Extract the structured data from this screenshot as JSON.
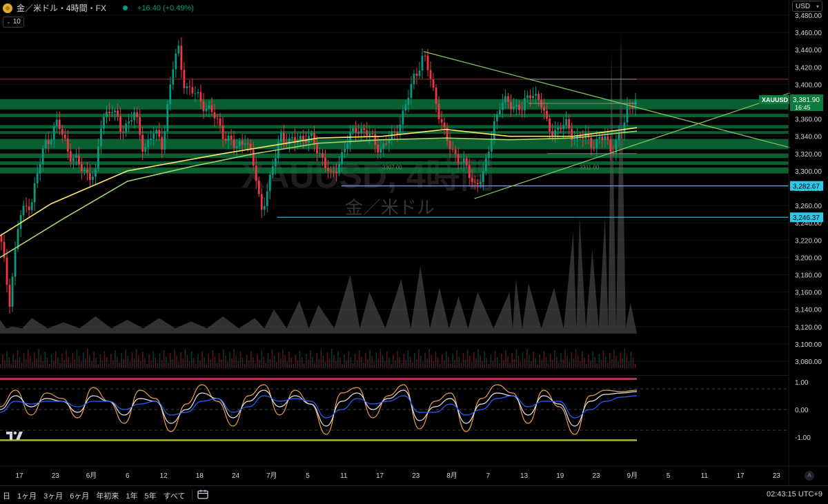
{
  "header": {
    "symbol_title": "金／米ドル・4時間・FX",
    "change": "+16.40 (+0.49%)",
    "interval_badge": "10",
    "currency": "USD"
  },
  "watermark": {
    "ticker": "XAUUSD, 4時間",
    "description": "金／米ドル"
  },
  "colors": {
    "background": "#000000",
    "up": "#089981",
    "down": "#f23645",
    "ma_yellow": "#ffeb6b",
    "ma_green": "#a5d66f",
    "trendline": "#7fc45c",
    "zone": "#0d7a3e",
    "hline_blue": "#2ec9e8",
    "hline_red": "#a22a2a",
    "osc_orange": "#f0a04b",
    "osc_white": "#e8e8e8",
    "osc_blue": "#2962ff"
  },
  "chart_data": [
    {
      "type": "candlestick",
      "title": "XAUUSD, 4時間",
      "symbol": "XAUUSD",
      "last_price": "3,381.90",
      "countdown": "16:45",
      "ylim": [
        3080,
        3480
      ],
      "y_ticks": [
        "3,480.00",
        "3,460.00",
        "3,440.00",
        "3,420.00",
        "3,400.00",
        "3,380.00",
        "3,360.00",
        "3,340.00",
        "3,320.00",
        "3,300.00",
        "3,280.00",
        "3,260.00",
        "3,240.00",
        "3,220.00",
        "3,200.00",
        "3,180.00",
        "3,160.00",
        "3,140.00",
        "3,120.00",
        "3,100.00",
        "3,080.00"
      ],
      "x_ticks": [
        "17",
        "23",
        "6月",
        "6",
        "12",
        "18",
        "24",
        "7月",
        "5",
        "11",
        "17",
        "23",
        "8月",
        "7",
        "13",
        "19",
        "23",
        "9月",
        "5",
        "11",
        "17",
        "23"
      ],
      "close_path": [
        [
          0,
          3225
        ],
        [
          0.015,
          3150
        ],
        [
          0.03,
          3245
        ],
        [
          0.05,
          3268
        ],
        [
          0.07,
          3330
        ],
        [
          0.09,
          3355
        ],
        [
          0.11,
          3320
        ],
        [
          0.13,
          3300
        ],
        [
          0.15,
          3295
        ],
        [
          0.16,
          3360
        ],
        [
          0.175,
          3375
        ],
        [
          0.19,
          3345
        ],
        [
          0.21,
          3368
        ],
        [
          0.225,
          3325
        ],
        [
          0.24,
          3345
        ],
        [
          0.255,
          3330
        ],
        [
          0.27,
          3415
        ],
        [
          0.28,
          3440
        ],
        [
          0.29,
          3400
        ],
        [
          0.31,
          3385
        ],
        [
          0.33,
          3370
        ],
        [
          0.35,
          3345
        ],
        [
          0.37,
          3325
        ],
        [
          0.385,
          3340
        ],
        [
          0.4,
          3300
        ],
        [
          0.41,
          3255
        ],
        [
          0.425,
          3290
        ],
        [
          0.44,
          3345
        ],
        [
          0.455,
          3330
        ],
        [
          0.47,
          3340
        ],
        [
          0.49,
          3335
        ],
        [
          0.505,
          3318
        ],
        [
          0.52,
          3290
        ],
        [
          0.54,
          3325
        ],
        [
          0.56,
          3352
        ],
        [
          0.58,
          3340
        ],
        [
          0.6,
          3325
        ],
        [
          0.62,
          3345
        ],
        [
          0.635,
          3368
        ],
        [
          0.65,
          3410
        ],
        [
          0.665,
          3432
        ],
        [
          0.675,
          3410
        ],
        [
          0.69,
          3365
        ],
        [
          0.7,
          3335
        ],
        [
          0.715,
          3320
        ],
        [
          0.73,
          3305
        ],
        [
          0.745,
          3285
        ],
        [
          0.76,
          3295
        ],
        [
          0.775,
          3355
        ],
        [
          0.785,
          3375
        ],
        [
          0.8,
          3380
        ],
        [
          0.82,
          3370
        ],
        [
          0.835,
          3395
        ],
        [
          0.85,
          3375
        ],
        [
          0.86,
          3352
        ],
        [
          0.875,
          3345
        ],
        [
          0.89,
          3355
        ],
        [
          0.905,
          3335
        ],
        [
          0.92,
          3340
        ],
        [
          0.935,
          3330
        ],
        [
          0.95,
          3340
        ],
        [
          0.96,
          3325
        ],
        [
          0.975,
          3340
        ],
        [
          0.985,
          3375
        ],
        [
          1.0,
          3382
        ]
      ],
      "moving_averages": [
        {
          "points": [
            [
              0,
              3225
            ],
            [
              0.08,
              3262
            ],
            [
              0.2,
              3300
            ],
            [
              0.35,
              3320
            ],
            [
              0.5,
              3338
            ],
            [
              0.6,
              3340
            ],
            [
              0.7,
              3348
            ],
            [
              0.8,
              3340
            ],
            [
              0.9,
              3340
            ],
            [
              1.0,
              3350
            ]
          ]
        },
        {
          "points": [
            [
              0,
              3200
            ],
            [
              0.1,
              3245
            ],
            [
              0.2,
              3288
            ],
            [
              0.3,
              3305
            ],
            [
              0.4,
              3320
            ],
            [
              0.5,
              3332
            ],
            [
              0.6,
              3336
            ],
            [
              0.7,
              3338
            ],
            [
              0.8,
              3336
            ],
            [
              0.9,
              3338
            ],
            [
              1.0,
              3346
            ]
          ]
        }
      ],
      "zones": [
        [
          3371,
          3383
        ],
        [
          3362,
          3366
        ],
        [
          3349,
          3353
        ],
        [
          3343,
          3346
        ],
        [
          3325,
          3337
        ],
        [
          3315,
          3320
        ],
        [
          3307,
          3311
        ],
        [
          3297,
          3304
        ]
      ],
      "horizontal_lines": [
        {
          "price": 3282.67,
          "label": "3,282.67",
          "x_from": 0.536,
          "color": "blue"
        },
        {
          "price": 3246.37,
          "label": "3,246.37",
          "x_from": 0.435,
          "color": "blue"
        },
        {
          "price": 3406,
          "x_from": 0.0,
          "color": "red"
        },
        {
          "price": 3406,
          "x_from": 0.83,
          "color": "gray"
        },
        {
          "price": 3378,
          "x_from": 0.83,
          "color": "gray"
        },
        {
          "price": 3320,
          "x_from": 0.86,
          "color": "gray"
        }
      ],
      "trendlines": [
        {
          "from": [
            0.665,
            3438
          ],
          "to": [
            1.24,
            3327
          ]
        },
        {
          "from": [
            0.745,
            3268
          ],
          "to": [
            1.24,
            3390
          ]
        }
      ],
      "small_labels": [
        {
          "text": "3307.00",
          "x": 0.6,
          "price": 3302
        },
        {
          "text": "3311.00",
          "x": 0.91,
          "price": 3302
        }
      ],
      "volume_peaks": [
        [
          0.47,
          3150
        ],
        [
          0.5,
          3145
        ],
        [
          0.55,
          3180
        ],
        [
          0.58,
          3160
        ],
        [
          0.63,
          3175
        ],
        [
          0.66,
          3190
        ],
        [
          0.69,
          3165
        ],
        [
          0.72,
          3155
        ],
        [
          0.75,
          3160
        ],
        [
          0.8,
          3160
        ],
        [
          0.81,
          3175
        ],
        [
          0.83,
          3170
        ],
        [
          0.87,
          3165
        ],
        [
          0.9,
          3230
        ],
        [
          0.91,
          3248
        ],
        [
          0.93,
          3210
        ],
        [
          0.95,
          3248
        ],
        [
          0.96,
          3440
        ],
        [
          0.975,
          3462
        ],
        [
          0.99,
          3148
        ]
      ]
    },
    {
      "type": "line",
      "title": "",
      "ylim": [
        -1.15,
        1.15
      ],
      "y_ticks": [
        "1.00",
        "0.00",
        "-1.00"
      ],
      "levels": [
        0.75,
        0,
        -0.75
      ],
      "series": [
        {
          "color": "orange",
          "values": [
            0.1,
            0.7,
            -0.2,
            0.6,
            0.4,
            -0.3,
            0.8,
            0.3,
            -0.5,
            0.7,
            0.4,
            -0.8,
            0.2,
            0.9,
            0.3,
            -0.6,
            0.5,
            0.9,
            -0.2,
            0.7,
            0.2,
            -0.9,
            0.6,
            0.8,
            -0.3,
            0.5,
            0.9,
            -0.7,
            0.3,
            0.6,
            -0.8,
            0.4,
            0.9,
            0.6,
            -0.5,
            0.7,
            0.1,
            -0.9,
            0.5,
            0.7,
            0.65,
            0.7
          ]
        },
        {
          "color": "white",
          "values": [
            0.0,
            0.5,
            0.1,
            0.4,
            0.3,
            -0.1,
            0.5,
            0.3,
            -0.2,
            0.4,
            0.3,
            -0.5,
            0.0,
            0.6,
            0.4,
            -0.3,
            0.3,
            0.7,
            0.1,
            0.5,
            0.2,
            -0.6,
            0.3,
            0.6,
            0.0,
            0.4,
            0.7,
            -0.4,
            0.1,
            0.4,
            -0.5,
            0.2,
            0.6,
            0.5,
            -0.2,
            0.5,
            0.2,
            -0.6,
            0.3,
            0.55,
            0.6,
            0.65
          ]
        },
        {
          "color": "blue",
          "values": [
            -0.1,
            0.3,
            0.2,
            0.3,
            0.3,
            0.1,
            0.3,
            0.3,
            0.0,
            0.2,
            0.3,
            -0.2,
            -0.1,
            0.3,
            0.4,
            -0.1,
            0.1,
            0.5,
            0.3,
            0.4,
            0.3,
            -0.3,
            0.0,
            0.4,
            0.2,
            0.3,
            0.5,
            -0.1,
            -0.1,
            0.2,
            -0.2,
            0.0,
            0.4,
            0.5,
            0.1,
            0.3,
            0.3,
            -0.3,
            0.0,
            0.3,
            0.45,
            0.5
          ]
        }
      ]
    }
  ],
  "bottom": {
    "ranges": [
      "日",
      "1ヶ月",
      "3ヶ月",
      "6ヶ月",
      "年初来",
      "1年",
      "5年",
      "すべて"
    ],
    "clock": "02:43:15 UTC+9",
    "auto_label": "A"
  }
}
